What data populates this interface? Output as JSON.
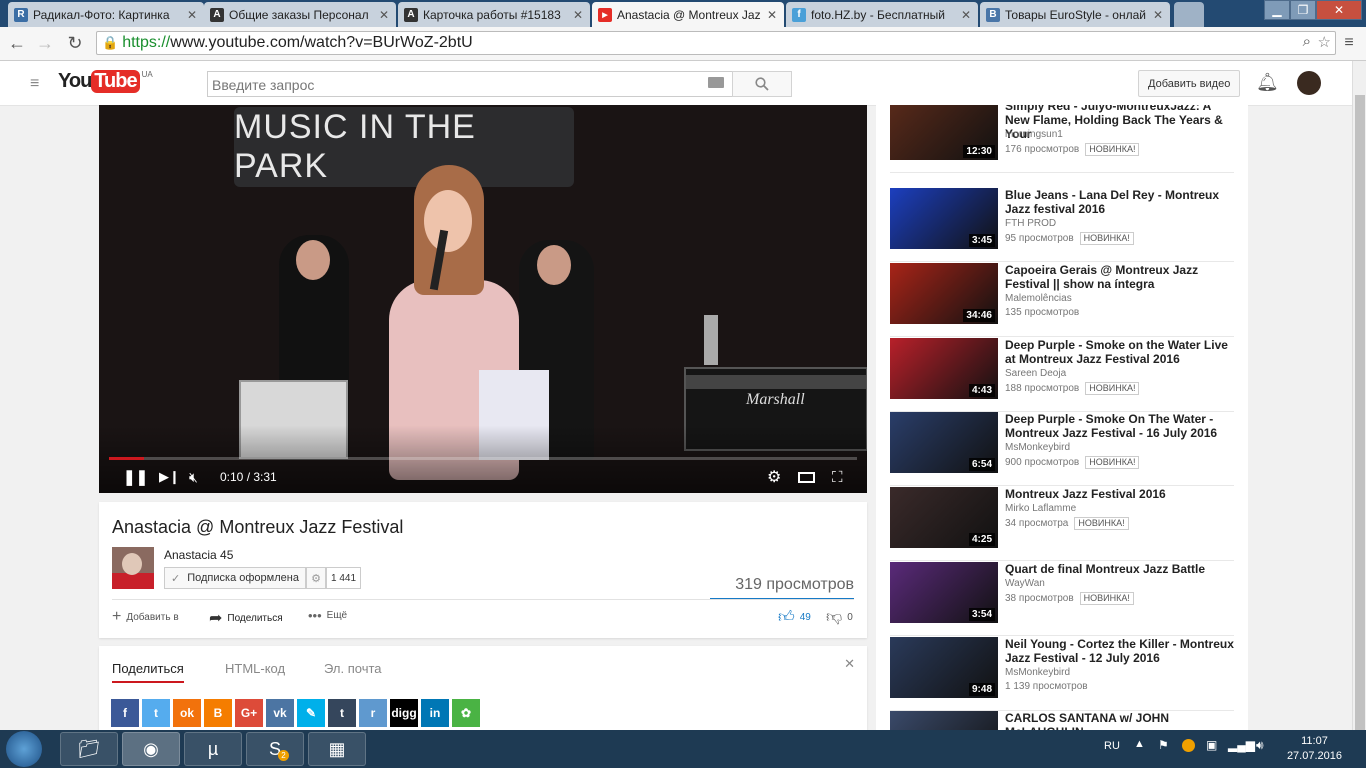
{
  "browser": {
    "tabs": [
      {
        "label": "Радикал-Фото: Картинка",
        "favicon": "R",
        "color": "#3b6ea5"
      },
      {
        "label": "Общие заказы Персонал",
        "favicon": "A",
        "color": "#333333"
      },
      {
        "label": "Карточка работы #15183",
        "favicon": "A",
        "color": "#333333"
      },
      {
        "label": "Anastacia @ Montreux Jaz",
        "favicon": "▶",
        "color": "#e52d27"
      },
      {
        "label": "foto.HZ.by - Бесплатный",
        "favicon": "f",
        "color": "#4aa0d8"
      },
      {
        "label": "Товары EuroStyle - онлай",
        "favicon": "B",
        "color": "#4a76a8"
      }
    ],
    "url_scheme": "https://",
    "url_rest": "www.youtube.com/watch?v=BUrWoZ-2btU"
  },
  "youtube": {
    "logo_text": "YouTube",
    "region": "UA",
    "search_placeholder": "Введите запрос",
    "upload_label": "Добавить видео"
  },
  "player": {
    "sign_text": "MUSIC IN THE PARK",
    "amp_text": "Marshall",
    "time": "0:10 / 3:31",
    "progress": 0.047
  },
  "video": {
    "title": "Anastacia @ Montreux Jazz Festival",
    "channel": "Anastacia 45",
    "subscribe_label": "Подписка оформлена",
    "subscribers": "1 441",
    "views": "319 просмотров",
    "add_label": "Добавить в",
    "share_label": "Поделиться",
    "more_label": "Ещё",
    "likes": "49",
    "dislikes": "0"
  },
  "share": {
    "tabs": [
      "Поделиться",
      "HTML-код",
      "Эл. почта"
    ],
    "icons": [
      {
        "name": "facebook",
        "glyph": "f",
        "color": "#3b5998"
      },
      {
        "name": "twitter",
        "glyph": "t",
        "color": "#55acee"
      },
      {
        "name": "odnoklassniki",
        "glyph": "ok",
        "color": "#f2720c"
      },
      {
        "name": "blogger",
        "glyph": "B",
        "color": "#f57d00"
      },
      {
        "name": "google-plus",
        "glyph": "G+",
        "color": "#dd4b39"
      },
      {
        "name": "vk",
        "glyph": "vk",
        "color": "#4c75a3"
      },
      {
        "name": "livejournal",
        "glyph": "✎",
        "color": "#00b0ea"
      },
      {
        "name": "tumblr",
        "glyph": "t",
        "color": "#35465c"
      },
      {
        "name": "reddit",
        "glyph": "r",
        "color": "#5f99cf"
      },
      {
        "name": "digg",
        "glyph": "digg",
        "color": "#000000"
      },
      {
        "name": "linkedin",
        "glyph": "in",
        "color": "#0077b5"
      },
      {
        "name": "stumbleupon",
        "glyph": "✿",
        "color": "#4ab344"
      }
    ]
  },
  "related": [
    {
      "title": "Simply Red - Julyo-MontreuxJazz: A New Flame, Holding Back The Years & Your",
      "channel": "morningsun1",
      "views": "176 просмотров",
      "badge": "НОВИНКА!",
      "duration": "12:30",
      "thumb": "#5a2a1a"
    },
    {
      "title": "Blue Jeans - Lana Del Rey - Montreux Jazz festival 2016",
      "channel": "FTH PROD",
      "views": "95 просмотров",
      "badge": "НОВИНКА!",
      "duration": "3:45",
      "thumb": "#1c3fbf"
    },
    {
      "title": "Capoeira Gerais @ Montreux Jazz Festival || show na íntegra",
      "channel": "Malemolências",
      "views": "135 просмотров",
      "badge": "",
      "duration": "34:46",
      "thumb": "#a82418"
    },
    {
      "title": "Deep Purple - Smoke on the Water Live at Montreux Jazz Festival 2016",
      "channel": "Sareen Deoja",
      "views": "188 просмотров",
      "badge": "НОВИНКА!",
      "duration": "4:43",
      "thumb": "#b8202a"
    },
    {
      "title": "Deep Purple - Smoke On The Water - Montreux Jazz Festival - 16 July 2016",
      "channel": "MsMonkeybird",
      "views": "900 просмотров",
      "badge": "НОВИНКА!",
      "duration": "6:54",
      "thumb": "#2a3e6a"
    },
    {
      "title": "Montreux Jazz Festival 2016",
      "channel": "Mirko Laflamme",
      "views": "34 просмотра",
      "badge": "НОВИНКА!",
      "duration": "4:25",
      "thumb": "#3a2a2a"
    },
    {
      "title": "Quart de final Montreux Jazz Battle",
      "channel": "WayWan",
      "views": "38 просмотров",
      "badge": "НОВИНКА!",
      "duration": "3:54",
      "thumb": "#5a2a7a"
    },
    {
      "title": "Neil Young - Cortez the Killer - Montreux Jazz Festival - 12 July 2016",
      "channel": "MsMonkeybird",
      "views": "1 139 просмотров",
      "badge": "",
      "duration": "9:48",
      "thumb": "#2a3a5a"
    },
    {
      "title": "CARLOS SANTANA w/ JOHN McLAUGHLIN",
      "channel": "",
      "views": "",
      "badge": "",
      "duration": "",
      "thumb": "#3a4a6a"
    }
  ],
  "taskbar": {
    "lang": "RU",
    "time": "11:07",
    "date": "27.07.2016",
    "skype_badge": "2"
  }
}
